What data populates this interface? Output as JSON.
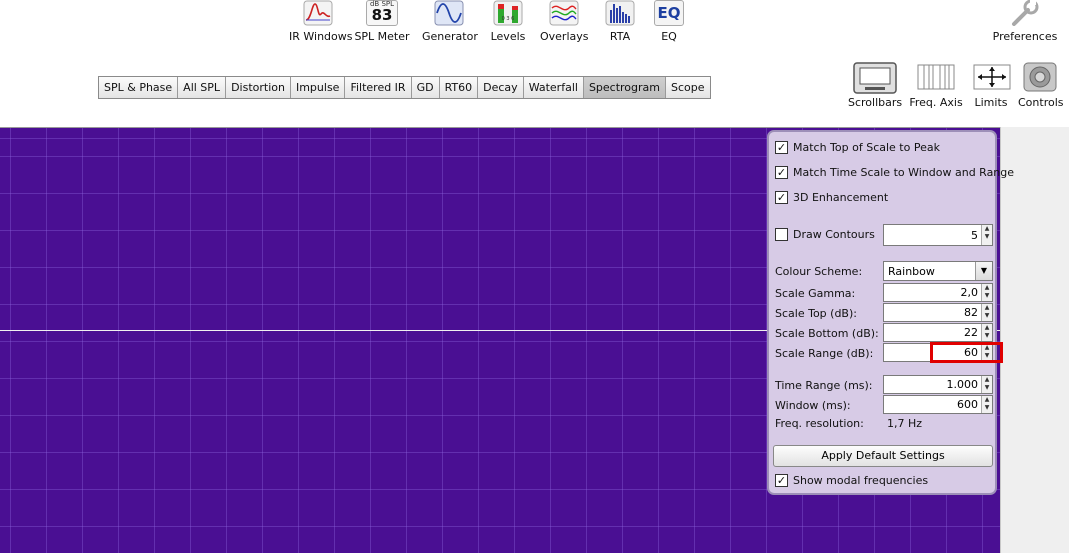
{
  "toolbar": {
    "ir_windows": "IR Windows",
    "spl_meter": "SPL Meter",
    "spl_meter_unit": "dB SPL",
    "spl_meter_value": "83",
    "generator": "Generator",
    "levels": "Levels",
    "overlays": "Overlays",
    "rta": "RTA",
    "eq": "EQ",
    "eq_icon_text": "EQ",
    "preferences": "Preferences"
  },
  "tabs": [
    "SPL & Phase",
    "All SPL",
    "Distortion",
    "Impulse",
    "Filtered IR",
    "GD",
    "RT60",
    "Decay",
    "Waterfall",
    "Spectrogram",
    "Scope"
  ],
  "active_tab": "Spectrogram",
  "view_tools": {
    "scrollbars": "Scrollbars",
    "freq_axis": "Freq. Axis",
    "limits": "Limits",
    "controls": "Controls"
  },
  "panel": {
    "match_top": {
      "label": "Match Top of Scale to Peak",
      "checked": true
    },
    "match_time": {
      "label": "Match Time Scale to Window and Range",
      "checked": true
    },
    "enhancement_3d": {
      "label": "3D Enhancement",
      "checked": true
    },
    "draw_contours": {
      "label": "Draw Contours",
      "checked": false,
      "value": "5"
    },
    "colour_scheme": {
      "label": "Colour Scheme:",
      "value": "Rainbow"
    },
    "scale_gamma": {
      "label": "Scale Gamma:",
      "value": "2,0"
    },
    "scale_top": {
      "label": "Scale Top (dB):",
      "value": "82"
    },
    "scale_bottom": {
      "label": "Scale Bottom (dB):",
      "value": "22"
    },
    "scale_range": {
      "label": "Scale Range (dB):",
      "value": "60"
    },
    "time_range": {
      "label": "Time Range (ms):",
      "value": "1.000"
    },
    "window": {
      "label": "Window (ms):",
      "value": "600"
    },
    "freq_resolution": {
      "label": "Freq. resolution:",
      "value": "1,7 Hz"
    },
    "apply_default": "Apply Default Settings",
    "show_modal": {
      "label": "Show modal frequencies",
      "checked": true
    }
  },
  "colors": {
    "graph_background": "#4a0f93",
    "panel_background": "#d7cbe6",
    "highlight": "#e00000"
  }
}
